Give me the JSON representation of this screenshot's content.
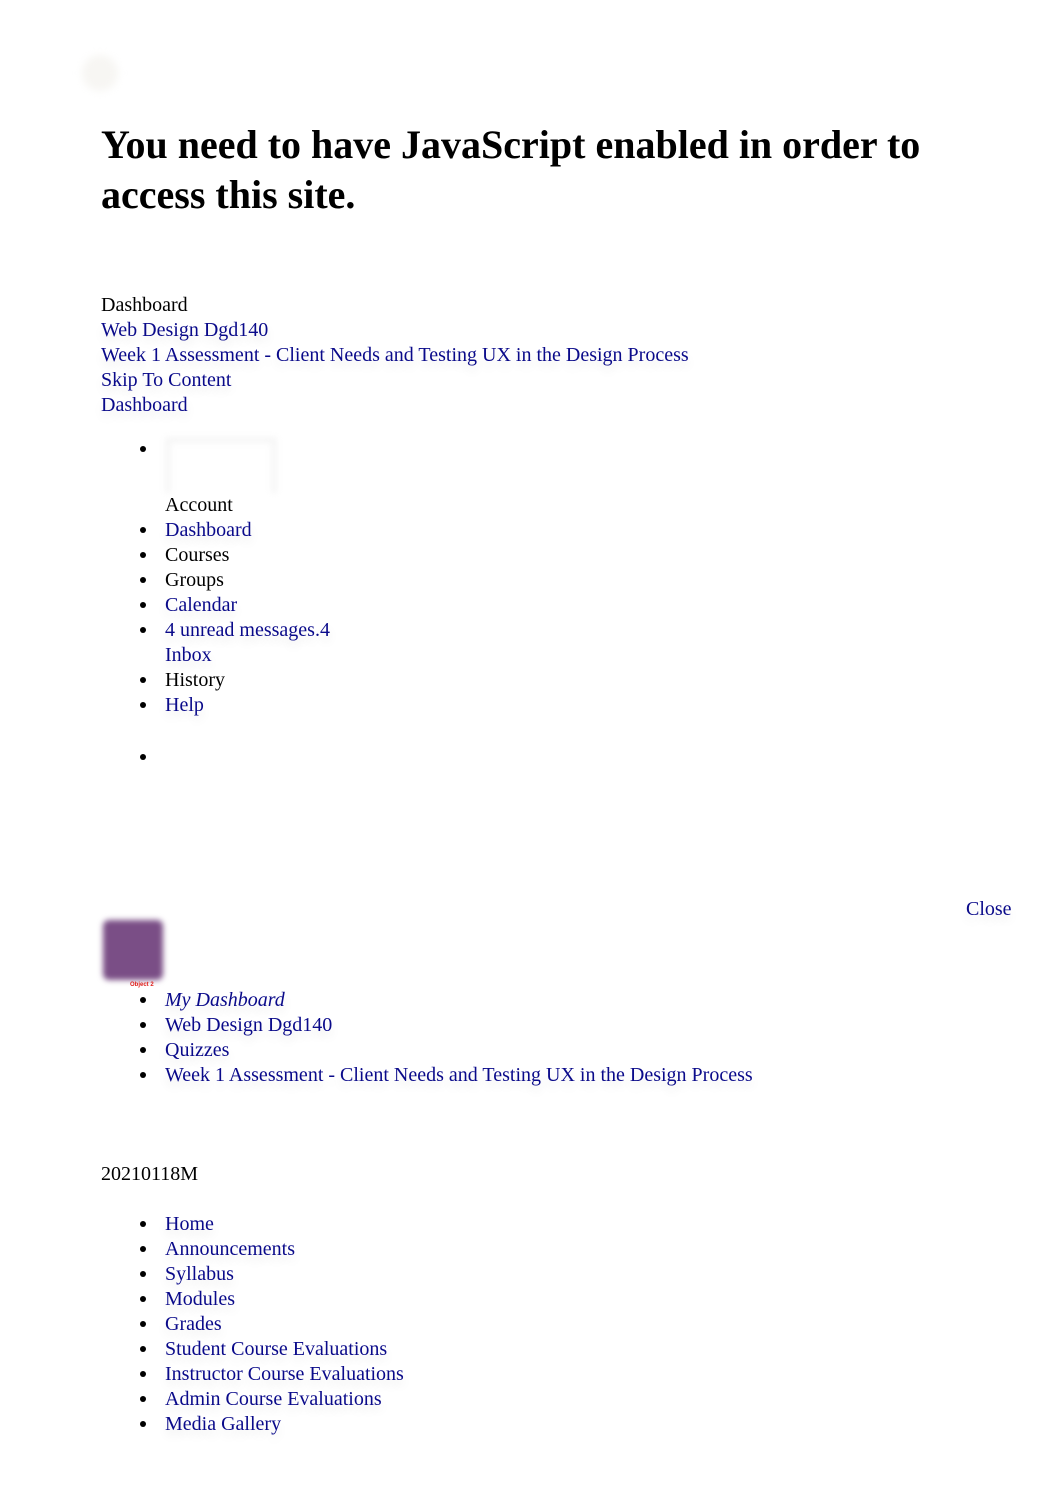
{
  "noscript_message": "You need to have JavaScript enabled in order to access this site.",
  "mobile_header": {
    "current": "Dashboard",
    "links": [
      "Web Design Dgd140",
      "Week 1 Assessment - Client Needs and Testing UX in the Design Process",
      "Skip To Content",
      "Dashboard"
    ]
  },
  "global_nav": {
    "items": [
      {
        "label": "Account",
        "link": false
      },
      {
        "label": "Dashboard",
        "link": true
      },
      {
        "label": "Courses",
        "link": false
      },
      {
        "label": "Groups",
        "link": false
      },
      {
        "label": "Calendar",
        "link": true
      },
      {
        "label": "4 unread messages.4",
        "sublabel": "Inbox",
        "link": true
      },
      {
        "label": "History",
        "link": false
      },
      {
        "label": "Help",
        "link": true
      }
    ]
  },
  "tray": {
    "close_label": "Close",
    "avatar_label": "Object 2"
  },
  "breadcrumbs": [
    "My Dashboard",
    "Web Design Dgd140",
    "Quizzes",
    "Week 1 Assessment - Client Needs and Testing UX in the Design Process"
  ],
  "course": {
    "code": "20210118M",
    "nav": [
      "Home",
      "Announcements",
      "Syllabus",
      "Modules",
      "Grades",
      "Student Course Evaluations",
      "Instructor Course Evaluations",
      "Admin Course Evaluations",
      "Media Gallery"
    ]
  },
  "colors": {
    "link": "#0a0a8a",
    "text": "#000000",
    "avatar": "#7a4e86",
    "avatar_label": "#e0201b"
  }
}
